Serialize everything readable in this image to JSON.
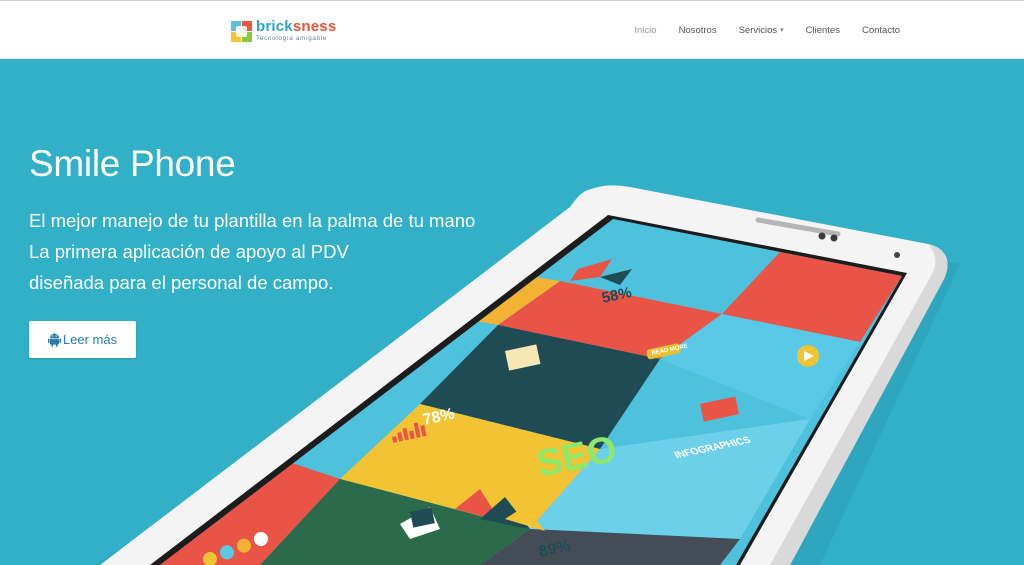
{
  "header": {
    "brand_part1": "brick",
    "brand_part2": "sness",
    "brand_tagline": "Tecnología amigable",
    "nav": [
      {
        "label": "Inicio",
        "active": true
      },
      {
        "label": "Nosotros"
      },
      {
        "label": "Servicios",
        "has_dropdown": true
      },
      {
        "label": "Clientes"
      },
      {
        "label": "Contacto"
      }
    ]
  },
  "hero": {
    "title": "Smile Phone",
    "subtitle_lines": [
      "El mejor manejo de tu plantilla en la palma de tu mano",
      "La primera aplicación de apoyo al PDV",
      "diseñada para el personal de campo."
    ],
    "cta_label": "Leer más",
    "cta_icon": "android-icon",
    "background_color": "#31b0c8"
  },
  "phone_screen": {
    "tiles": {
      "stat_top": "58%",
      "stat_left": "78%",
      "stat_bottom": "89%",
      "seo_title": "SEO",
      "seo_subtitle": "INFOGRAPHICS",
      "read_more": "READ MORE"
    }
  }
}
